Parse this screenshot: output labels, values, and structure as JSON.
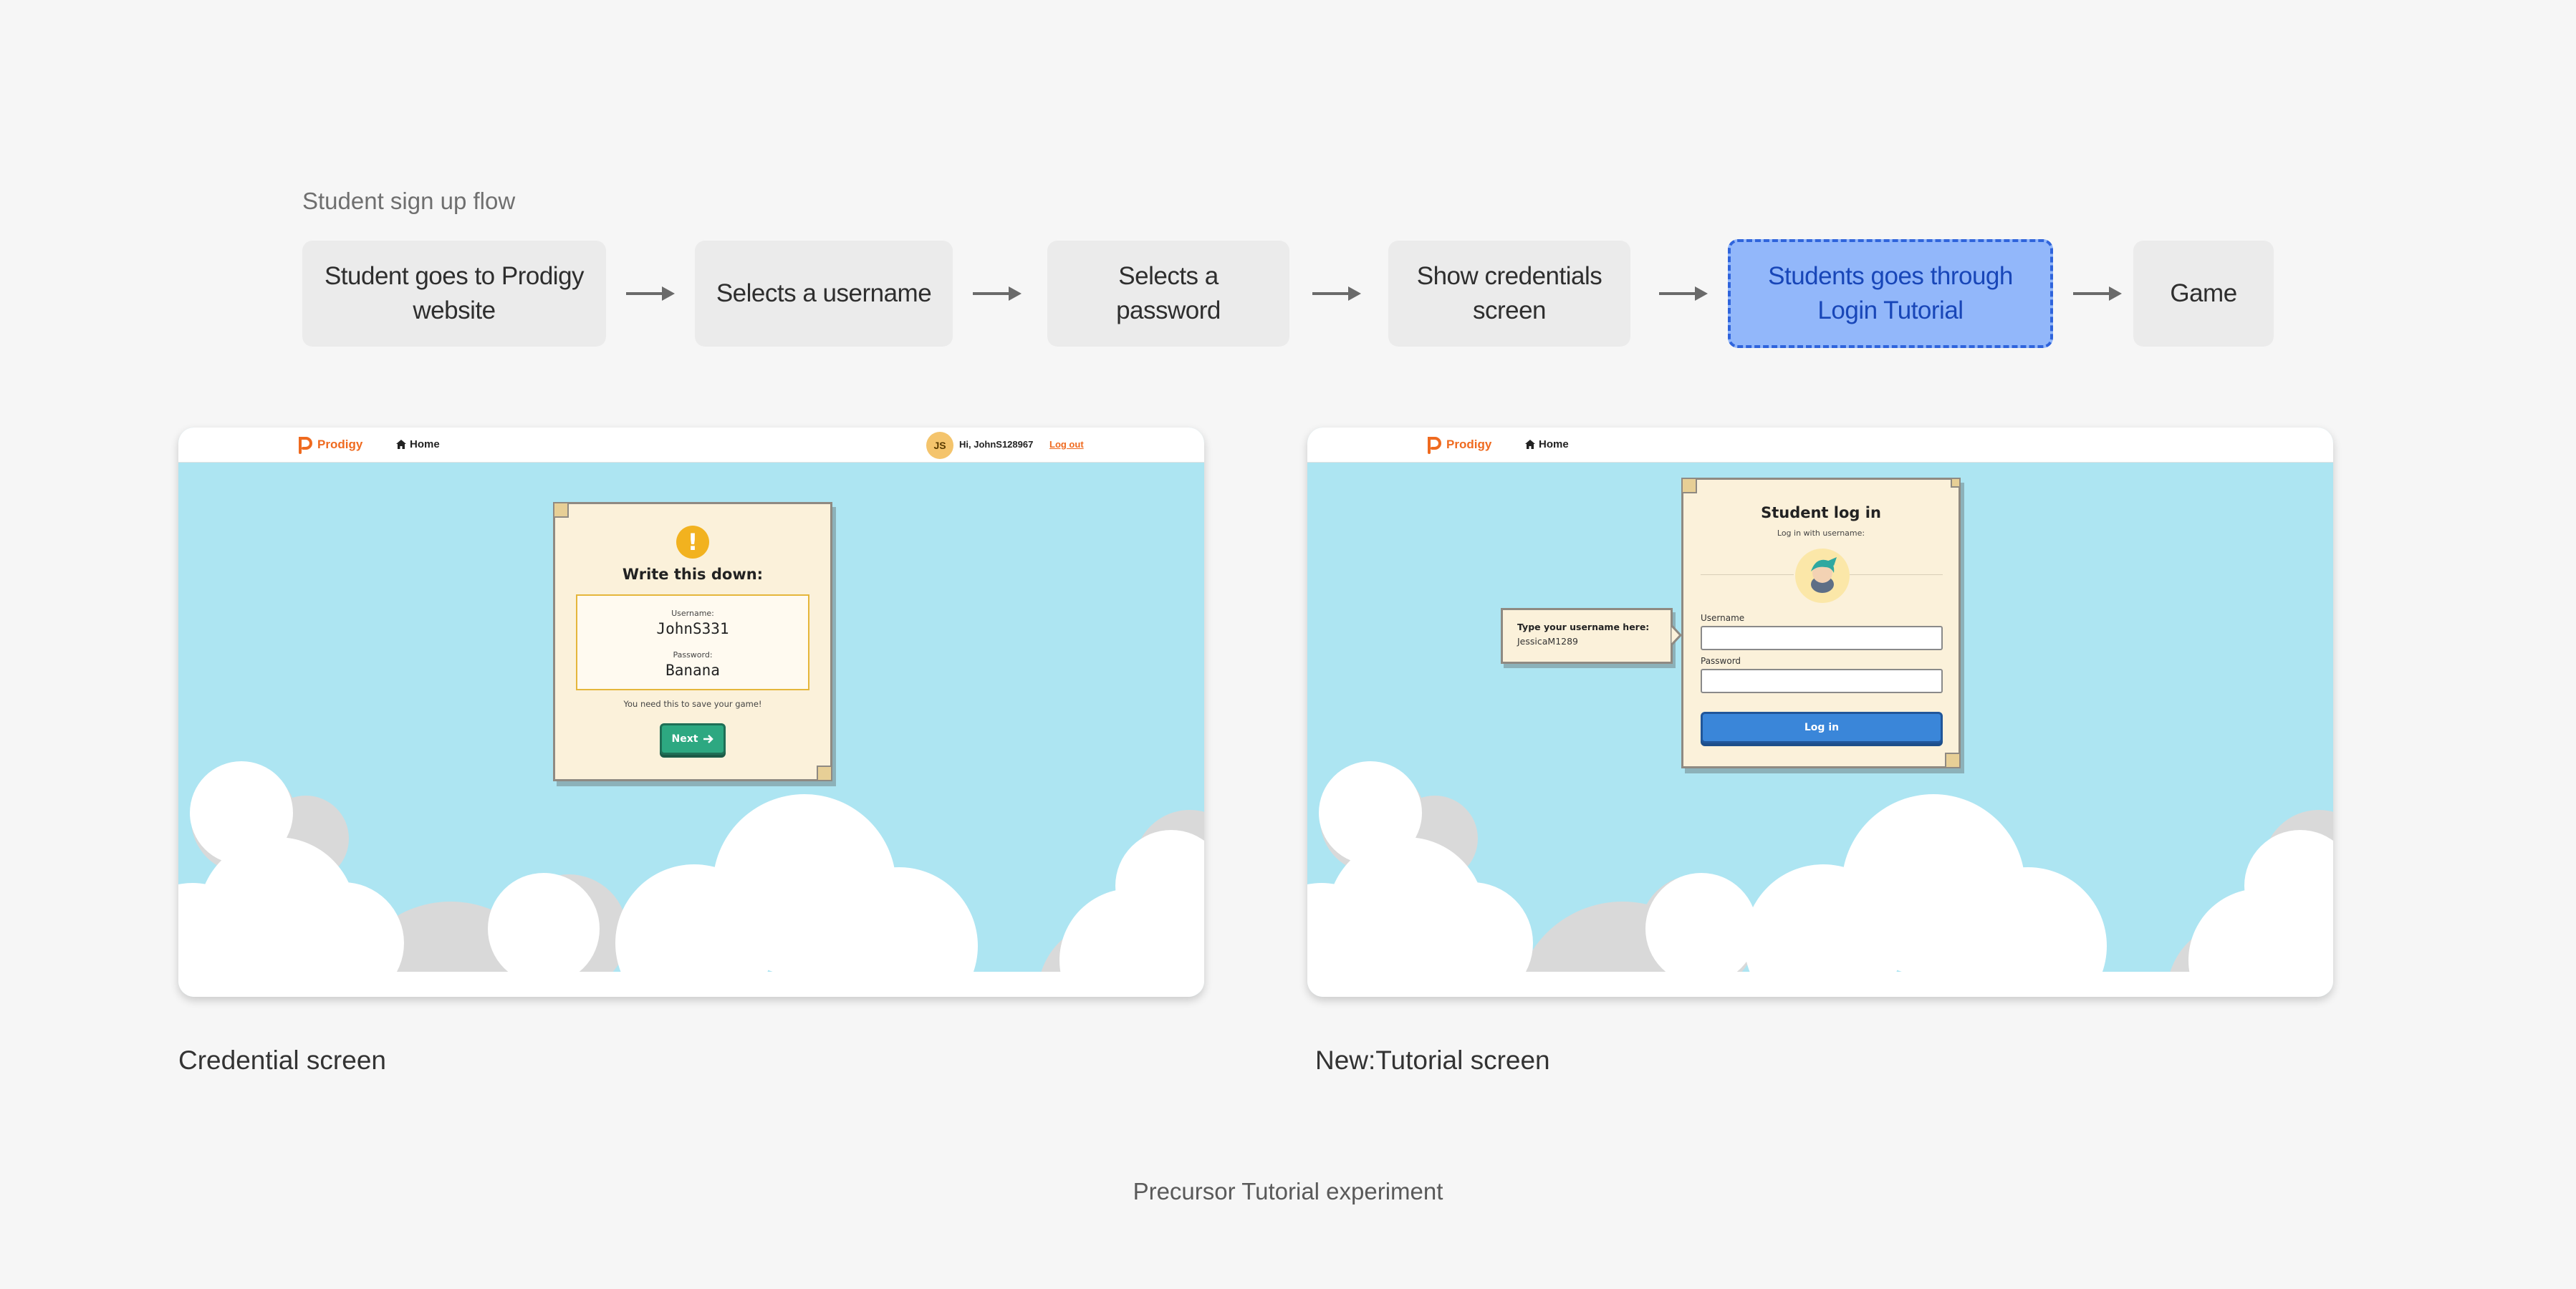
{
  "flow": {
    "title": "Student sign up flow",
    "steps": [
      "Student goes to Prodigy website",
      "Selects a username",
      "Selects a password",
      "Show credentials screen",
      "Students goes through Login Tutorial",
      "Game"
    ],
    "highlight_color": "#92b7fa",
    "highlight_border": "#2f64dc"
  },
  "credential_card": {
    "brand": "Prodigy",
    "nav_home": "Home",
    "avatar_initials": "JS",
    "greeting": "Hi, JohnS128967",
    "logout": "Log out",
    "panel": {
      "title": "Write this down:",
      "username_label": "Username:",
      "username": "JohnS331",
      "password_label": "Password:",
      "password": "Banana",
      "note": "You need this to save your game!",
      "next_label": "Next"
    },
    "caption": "Credential screen"
  },
  "tutorial_card": {
    "brand": "Prodigy",
    "nav_home": "Home",
    "panel": {
      "title": "Student log in",
      "subtitle": "Log in with username:",
      "username_label": "Username",
      "password_label": "Password",
      "login_label": "Log in"
    },
    "tooltip": {
      "title": "Type your username here:",
      "value": "JessicaM1289"
    },
    "caption": "New:Tutorial screen"
  },
  "footer": "Precursor Tutorial experiment",
  "colors": {
    "brand_orange": "#ef6a1f",
    "sky": "#ade5f2",
    "next_green": "#2da881",
    "login_blue": "#3a86d9"
  }
}
